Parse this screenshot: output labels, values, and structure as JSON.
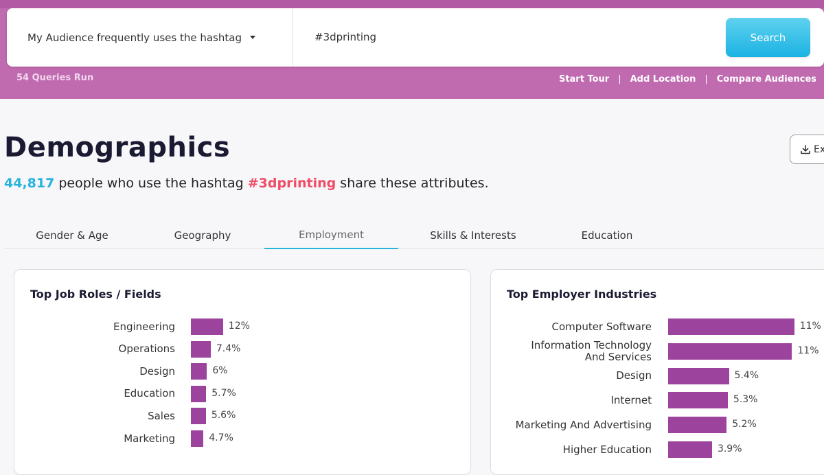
{
  "search": {
    "query_type": "My Audience frequently uses the hashtag",
    "query_value": "#3dprinting",
    "search_label": "Search"
  },
  "status": {
    "queries_run": "54 Queries Run"
  },
  "links": {
    "start_tour": "Start Tour",
    "add_location": "Add Location",
    "compare_audiences": "Compare Audiences",
    "separator": "|"
  },
  "demographics": {
    "title": "Demographics",
    "count": "44,817",
    "text_before_tag": " people who use the hashtag ",
    "hashtag": "#3dprinting",
    "text_after_tag": " share these attributes.",
    "export_label": "Export"
  },
  "tabs": [
    {
      "label": "Gender & Age",
      "active": false
    },
    {
      "label": "Geography",
      "active": false
    },
    {
      "label": "Employment",
      "active": true
    },
    {
      "label": "Skills & Interests",
      "active": false
    },
    {
      "label": "Education",
      "active": false
    }
  ],
  "colors": {
    "accent_blue": "#26b3df",
    "hashtag_red": "#ef4d67",
    "bar_purple": "#9c449d",
    "band_purple": "#c06ab0"
  },
  "job_roles": {
    "title": "Top Job Roles / Fields",
    "items": [
      {
        "label": "Engineering",
        "value": 12,
        "display": "12%"
      },
      {
        "label": "Operations",
        "value": 7.4,
        "display": "7.4%"
      },
      {
        "label": "Design",
        "value": 6,
        "display": "6%"
      },
      {
        "label": "Education",
        "value": 5.7,
        "display": "5.7%"
      },
      {
        "label": "Sales",
        "value": 5.6,
        "display": "5.6%"
      },
      {
        "label": "Marketing",
        "value": 4.7,
        "display": "4.7%"
      }
    ]
  },
  "industries": {
    "title": "Top Employer Industries",
    "items": [
      {
        "label": "Computer Software",
        "value": 11.2,
        "display": "11%"
      },
      {
        "label": "Information Technology And Services",
        "value": 11,
        "display": "11%"
      },
      {
        "label": "Design",
        "value": 5.4,
        "display": "5.4%"
      },
      {
        "label": "Internet",
        "value": 5.3,
        "display": "5.3%"
      },
      {
        "label": "Marketing And Advertising",
        "value": 5.2,
        "display": "5.2%"
      },
      {
        "label": "Higher Education",
        "value": 3.9,
        "display": "3.9%"
      }
    ]
  }
}
